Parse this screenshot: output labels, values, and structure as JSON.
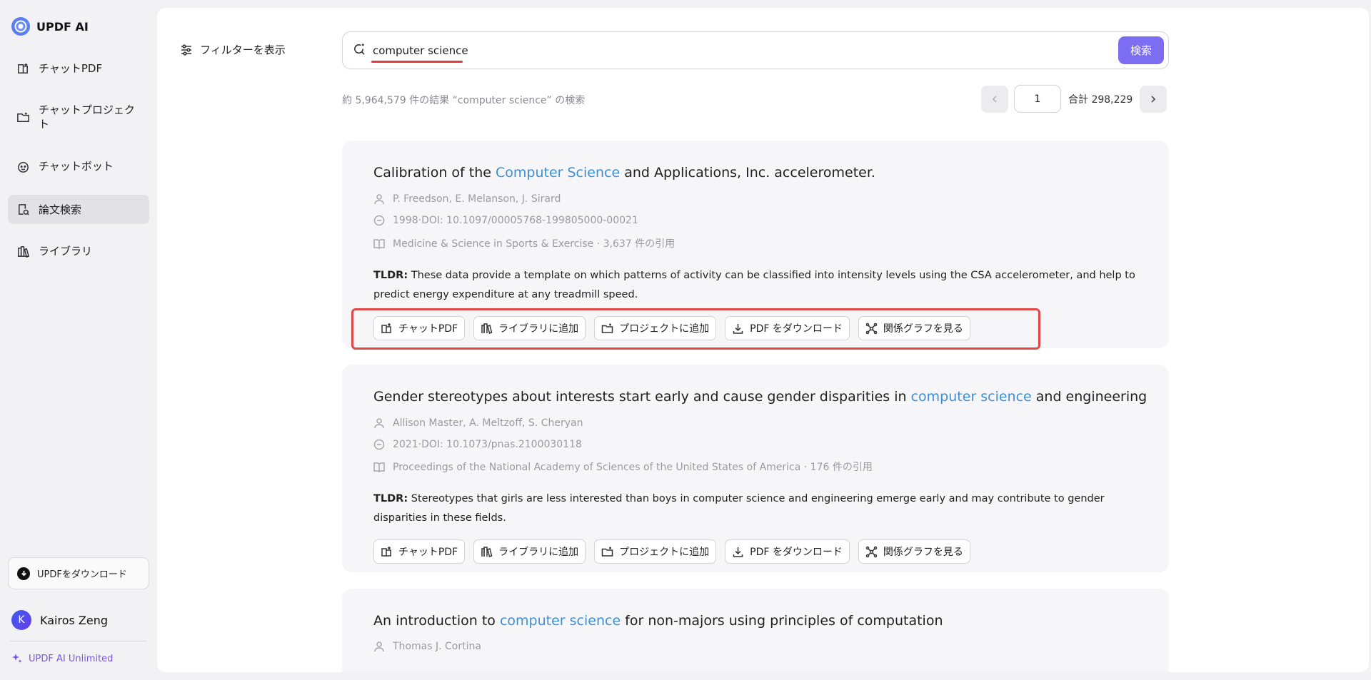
{
  "app": {
    "name": "UPDF AI"
  },
  "sidebar": {
    "items": [
      {
        "label": "チャットPDF",
        "icon": "chat-pdf-icon"
      },
      {
        "label": "チャットプロジェクト",
        "icon": "folder-icon"
      },
      {
        "label": "チャットボット",
        "icon": "bot-icon"
      },
      {
        "label": "論文検索",
        "icon": "paper-search-icon",
        "active": true
      },
      {
        "label": "ライブラリ",
        "icon": "library-icon"
      }
    ],
    "download_label": "UPDFをダウンロード",
    "user_initial": "K",
    "user_name": "Kairos Zeng",
    "plan_label": "UPDF AI Unlimited"
  },
  "toolbar": {
    "filter_label": "フィルターを表示",
    "search_value": "computer science",
    "search_button": "検索"
  },
  "results": {
    "count_text": "約 5,964,579 件の結果 “computer science” の検索",
    "page": "1",
    "total_text": "合計 298,229"
  },
  "action_labels": {
    "chat_pdf": "チャットPDF",
    "add_library": "ライブラリに追加",
    "add_project": "プロジェクトに追加",
    "download_pdf": "PDF をダウンロード",
    "view_graph": "関係グラフを見る"
  },
  "papers": [
    {
      "title_pre": "Calibration of the ",
      "title_hl": "Computer Science",
      "title_post": " and Applications, Inc. accelerometer.",
      "authors": "P. Freedson,  E. Melanson,  J. Sirard",
      "doi": "1998·DOI: 10.1097/00005768-199805000-00021",
      "venue": "Medicine & Science in Sports & Exercise · 3,637 件の引用",
      "tldr_label": "TLDR:",
      "tldr": "These data provide a template on which patterns of activity can be classified into intensity levels using the CSA accelerometer, and help to predict energy expenditure at any treadmill speed."
    },
    {
      "title_pre": "Gender stereotypes about interests start early and cause gender disparities in ",
      "title_hl": "computer science",
      "title_post": " and engineering",
      "authors": "Allison Master,  A. Meltzoff,  S. Cheryan",
      "doi": "2021·DOI: 10.1073/pnas.2100030118",
      "venue": "Proceedings of the National Academy of Sciences of the United States of America · 176 件の引用",
      "tldr_label": "TLDR:",
      "tldr": "Stereotypes that girls are less interested than boys in computer science and engineering emerge early and may contribute to gender disparities in these fields."
    },
    {
      "title_pre": "An introduction to ",
      "title_hl": "computer science",
      "title_post": " for non-majors using principles of computation",
      "authors": "Thomas J. Cortina"
    }
  ],
  "colors": {
    "accent": "#7c6df2",
    "highlight": "#3f8fd6",
    "annotation_red": "#e04848"
  }
}
